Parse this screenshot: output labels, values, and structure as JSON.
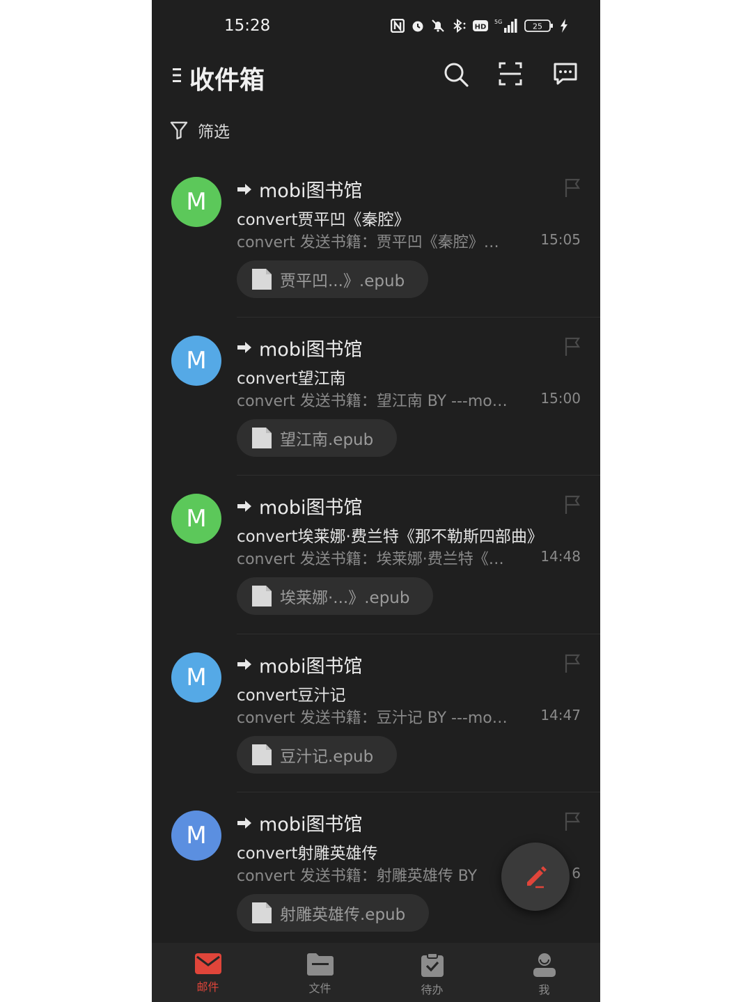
{
  "status_bar": {
    "time": "15:28",
    "network": "5G",
    "battery": "25"
  },
  "header": {
    "title": "收件箱",
    "icons": [
      "menu-icon",
      "search-icon",
      "scan-icon",
      "message-icon"
    ]
  },
  "filter": {
    "label": "筛选"
  },
  "mails": [
    {
      "avatar_letter": "M",
      "avatar_color": "#5cc85a",
      "sender": "mobi图书馆",
      "subject": "convert贾平凹《秦腔》",
      "preview": "convert 发送书籍：贾平凹《秦腔》…",
      "time": "15:05",
      "attachment": "贾平凹...》.epub"
    },
    {
      "avatar_letter": "M",
      "avatar_color": "#55a9e6",
      "sender": "mobi图书馆",
      "subject": "convert望江南",
      "preview": "convert 发送书籍：望江南 BY ---mo…",
      "time": "15:00",
      "attachment": "望江南.epub"
    },
    {
      "avatar_letter": "M",
      "avatar_color": "#5cc85a",
      "sender": "mobi图书馆",
      "subject": "convert埃莱娜·费兰特《那不勒斯四部曲》",
      "preview": "convert 发送书籍：埃莱娜·费兰特《…",
      "time": "14:48",
      "attachment": "埃莱娜·...》.epub"
    },
    {
      "avatar_letter": "M",
      "avatar_color": "#55a9e6",
      "sender": "mobi图书馆",
      "subject": "convert豆汁记",
      "preview": "convert 发送书籍：豆汁记 BY ---mo…",
      "time": "14:47",
      "attachment": "豆汁记.epub"
    },
    {
      "avatar_letter": "M",
      "avatar_color": "#5b8fe0",
      "sender": "mobi图书馆",
      "subject": "convert射雕英雄传",
      "preview": "convert 发送书籍：射雕英雄传 BY",
      "time": "6",
      "attachment": "射雕英雄传.epub"
    }
  ],
  "fab": {
    "icon": "compose-pencil-icon"
  },
  "bottom_nav": [
    {
      "label": "邮件",
      "icon": "mail-icon",
      "active": true
    },
    {
      "label": "文件",
      "icon": "folder-icon",
      "active": false
    },
    {
      "label": "待办",
      "icon": "clipboard-check-icon",
      "active": false
    },
    {
      "label": "我",
      "icon": "profile-icon",
      "active": false
    }
  ],
  "colors": {
    "background": "#1f1f1f",
    "accent": "#e0453a",
    "muted_text": "#8a8a8a"
  }
}
